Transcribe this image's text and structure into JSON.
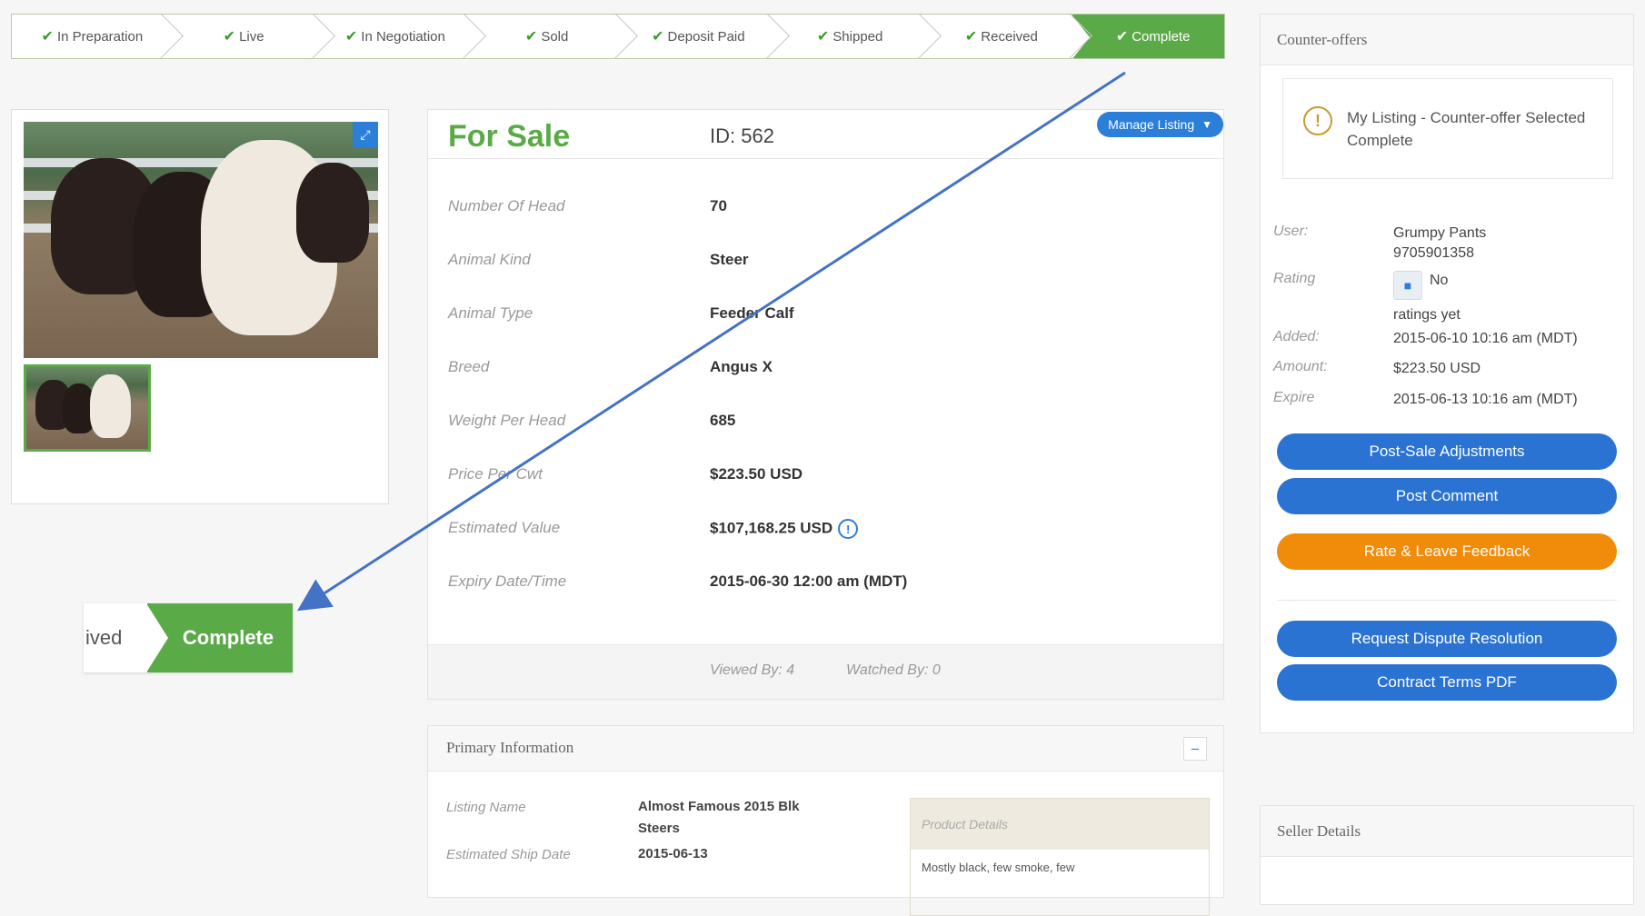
{
  "steps": [
    {
      "label": "In Preparation"
    },
    {
      "label": "Live"
    },
    {
      "label": "In Negotiation"
    },
    {
      "label": "Sold"
    },
    {
      "label": "Deposit Paid"
    },
    {
      "label": "Shipped"
    },
    {
      "label": "Received"
    },
    {
      "label": "Complete"
    }
  ],
  "zoom_badge": {
    "prev": "ived",
    "current": "Complete"
  },
  "listing": {
    "status": "For Sale",
    "id": "ID: 562",
    "manage_label": "Manage Listing",
    "fields": [
      {
        "label": "Number Of Head",
        "value": "70"
      },
      {
        "label": "Animal Kind",
        "value": "Steer"
      },
      {
        "label": "Animal Type",
        "value": "Feeder Calf"
      },
      {
        "label": "Breed",
        "value": "Angus X"
      },
      {
        "label": "Weight Per Head",
        "value": "685"
      },
      {
        "label": "Price Per Cwt",
        "value": "$223.50 USD"
      },
      {
        "label": "Estimated Value",
        "value": "$107,168.25 USD"
      },
      {
        "label": "Expiry Date/Time",
        "value": "2015-06-30 12:00 am (MDT)"
      }
    ],
    "viewed_by": "Viewed By: 4",
    "watched_by": "Watched By: 0"
  },
  "primary": {
    "title": "Primary Information",
    "listing_name_label": "Listing Name",
    "listing_name": "Almost Famous 2015 Blk Steers",
    "ship_date_label": "Estimated Ship Date",
    "ship_date": "2015-06-13",
    "product_details_label": "Product Details",
    "product_details": "Mostly black, few smoke, few"
  },
  "counter": {
    "title": "Counter-offers",
    "alert": "My Listing - Counter-offer Selected Complete",
    "user_label": "User:",
    "user": "Grumpy Pants",
    "phone": "9705901358",
    "rating_label": "Rating",
    "rating_1": "No",
    "rating_2": "ratings yet",
    "added_label": "Added:",
    "added": "2015-06-10 10:16 am (MDT)",
    "amount_label": "Amount:",
    "amount": "$223.50 USD",
    "expire_label": "Expire",
    "expire": "2015-06-13 10:16 am (MDT)",
    "btn_post_sale": "Post-Sale Adjustments",
    "btn_post_comment": "Post Comment",
    "btn_rate": "Rate & Leave Feedback",
    "btn_dispute": "Request Dispute Resolution",
    "btn_contract": "Contract Terms PDF"
  },
  "seller": {
    "title": "Seller Details"
  },
  "icons": {
    "check": "check-icon",
    "expand": "expand-icon",
    "chevron": "chevron-down-icon",
    "info": "info-icon",
    "alert": "exclamation-icon",
    "chat": "chat-icon",
    "collapse": "minus-icon"
  },
  "colors": {
    "green": "#5aaa47",
    "blue": "#2b73d3",
    "orange": "#f08c0a",
    "arrow": "#4472c4"
  }
}
